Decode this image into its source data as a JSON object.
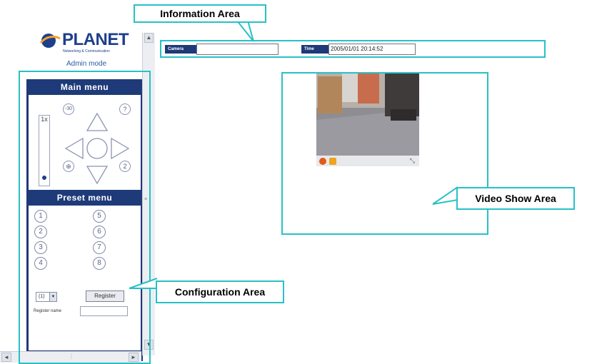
{
  "brand": {
    "logo_text": "PLANET",
    "logo_sub": "Networking & Communication",
    "mode": "Admin mode"
  },
  "main_menu": {
    "title": "Main menu",
    "zoom_label": "1x",
    "buttons": {
      "rewind": "-30",
      "help": "?",
      "home": "⊕",
      "two": "2"
    }
  },
  "preset_menu": {
    "title": "Preset menu",
    "presets": [
      "1",
      "2",
      "3",
      "4",
      "5",
      "6",
      "7",
      "8"
    ]
  },
  "register": {
    "select_value": "(1)",
    "button_label": "Register",
    "name_label": "Register name",
    "name_value": ""
  },
  "info": {
    "camera_label": "Camera",
    "camera_value": "",
    "time_label": "Time",
    "time_value": "2005/01/01 20:14:52"
  },
  "callouts": {
    "information_area": "Information Area",
    "video_show_area": "Video Show Area",
    "configuration_area": "Configuration Area"
  },
  "colors": {
    "callout_border": "#28c1c6",
    "panel_navy": "#1e3a78",
    "brand_blue": "#1d3f8c"
  }
}
